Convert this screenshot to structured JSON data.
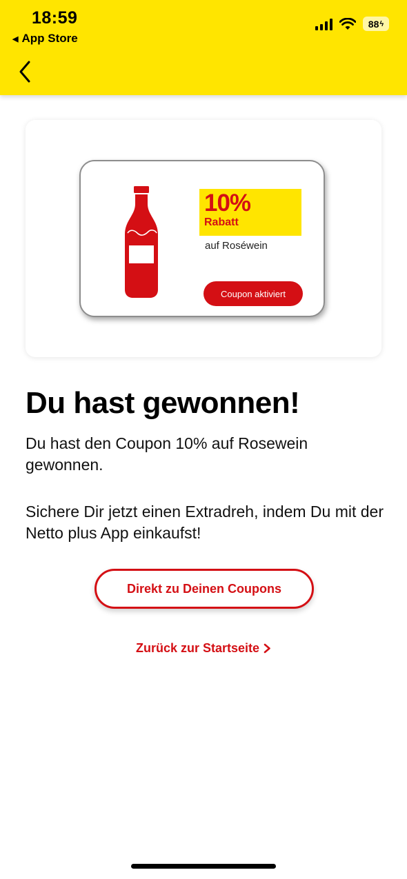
{
  "status_bar": {
    "time": "18:59",
    "back_app": "App Store",
    "battery": "88"
  },
  "colors": {
    "brand_yellow": "#FFE500",
    "brand_red": "#D40F14"
  },
  "icons": {
    "nav_back": "chevron-left-icon",
    "back_app": "triangle-left-icon",
    "signal": "cellular-signal-icon",
    "wifi": "wifi-icon",
    "battery": "battery-charging-icon",
    "bottle": "wine-bottle-icon",
    "link_arrow": "chevron-right-icon"
  },
  "coupon": {
    "discount": "10%",
    "discount_label": "Rabatt",
    "product": "auf Roséwein",
    "status_button": "Coupon aktiviert"
  },
  "main": {
    "headline": "Du hast gewonnen!",
    "paragraph_1": "Du hast den Coupon 10% auf Rosewein  gewonnen.",
    "paragraph_2": "Sichere Dir jetzt einen Extradreh, indem Du mit der Netto plus App einkaufst!",
    "primary_button": "Direkt zu Deinen Coupons",
    "secondary_link": "Zurück zur Startseite"
  }
}
